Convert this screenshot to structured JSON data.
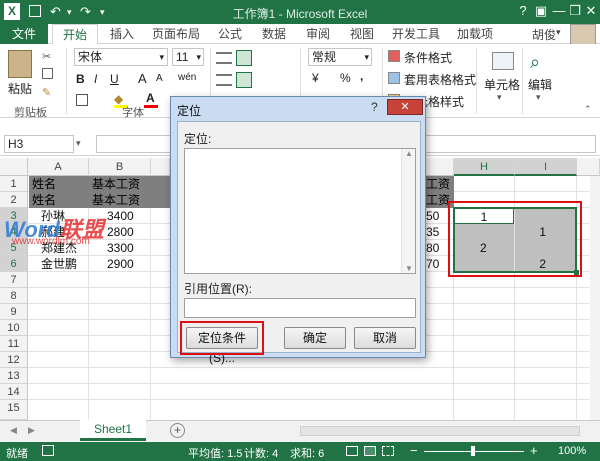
{
  "window": {
    "title": "工作簿1 - Microsoft Excel",
    "help": "?",
    "minimize": "—",
    "restore": "❐",
    "close": "✕"
  },
  "qat": {
    "undo": "↶",
    "redo": "↷",
    "customize": "▾"
  },
  "tabs": [
    "文件",
    "开始",
    "插入",
    "页面布局",
    "公式",
    "数据",
    "审阅",
    "视图",
    "开发工具",
    "加载项"
  ],
  "user": "胡俊",
  "ribbon": {
    "paste_label": "粘贴",
    "font_name": "宋体",
    "font_size": "11",
    "bold": "B",
    "italic": "I",
    "underline": "U",
    "grow": "A",
    "shrink": "A",
    "wen": "wén",
    "number_format": "常规",
    "currency": "¥",
    "percent": "%",
    "comma": ",",
    "cond_format": "条件格式",
    "table_format": "套用表格格式",
    "cell_style": "单元格样式",
    "cells_label": "单元格",
    "edit_label": "编辑",
    "group_clipboard": "剪贴板",
    "group_font": "字体"
  },
  "namebox": "H3",
  "columns": [
    "A",
    "B",
    "H",
    "I"
  ],
  "rows": [
    "1",
    "2",
    "3",
    "4",
    "5",
    "6",
    "7",
    "8",
    "9",
    "10",
    "11",
    "12",
    "13",
    "14",
    "15"
  ],
  "sheet_data": {
    "a1": "姓名",
    "b1": "基本工资",
    "a2": "姓名",
    "b2": "基本工资",
    "a3": "孙琳",
    "b3": "3400",
    "a4": "郝建",
    "b4": "2800",
    "a5": "郑建杰",
    "b5": "3300",
    "a6": "金世鹏",
    "b6": "2900",
    "g1": "工资",
    "g2": "工资",
    "g3": "50",
    "g4": "35",
    "g5": "80",
    "g6": "70",
    "h3": "1",
    "i4": "1",
    "h5": "2",
    "i6": "2"
  },
  "watermark": {
    "word": "Word",
    "lianmeng": "联盟",
    "url": "www.wordlm.com"
  },
  "dialog": {
    "title": "定位",
    "list_label": "定位:",
    "ref_label": "引用位置(R):",
    "special_button": "定位条件(S)...",
    "ok_button": "确定",
    "cancel_button": "取消",
    "help": "?",
    "close": "✕"
  },
  "sheet_tab": "Sheet1",
  "add_sheet": "+",
  "status": {
    "ready": "就绪",
    "average": "平均值: 1.5",
    "count": "计数: 4",
    "sum": "求和: 6",
    "zoom": "100%",
    "minus": "−",
    "plus": "+"
  },
  "colors": {
    "accent": "#217346",
    "highlight": "#d11111"
  }
}
